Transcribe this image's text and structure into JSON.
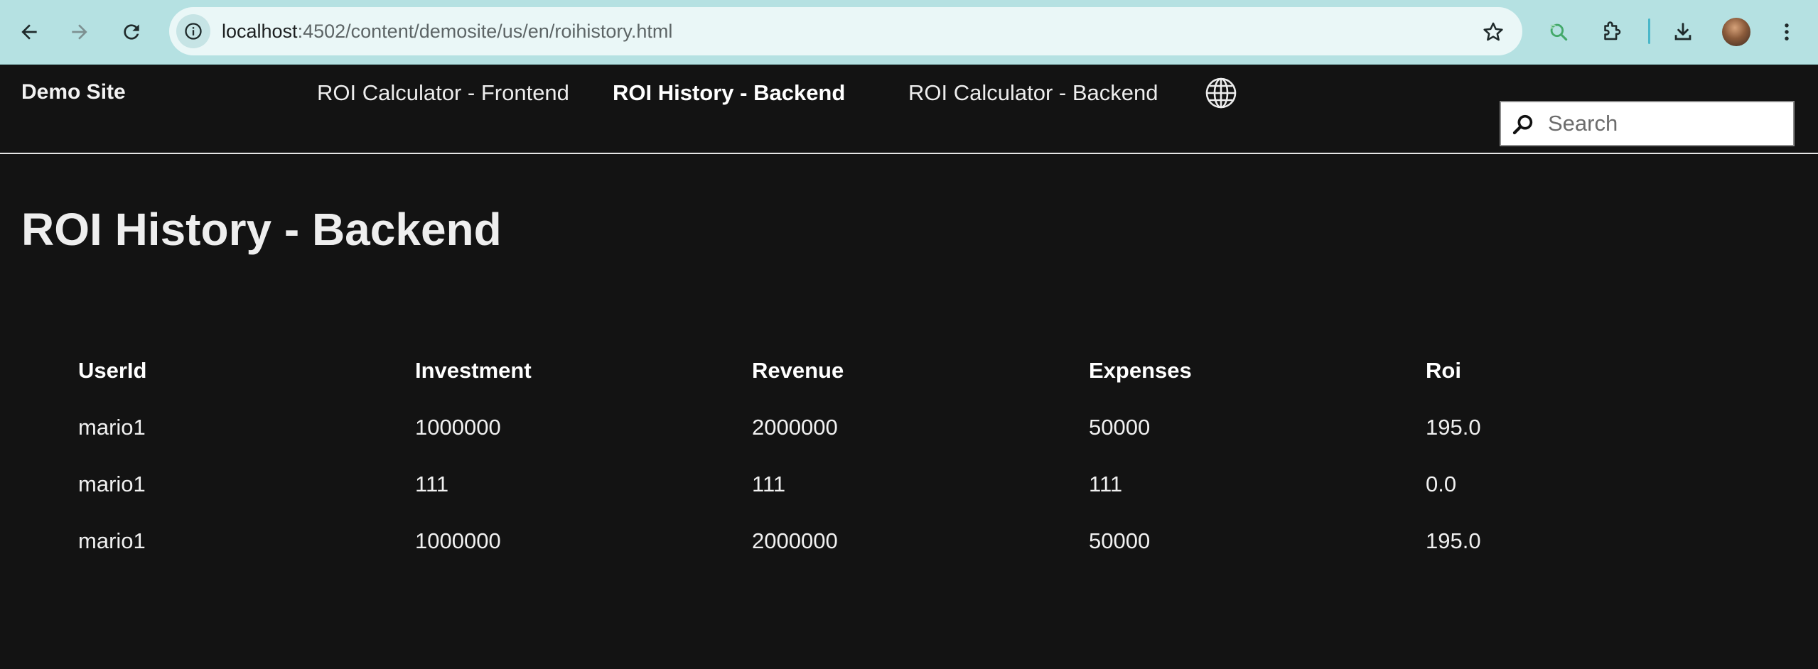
{
  "browser": {
    "url_host": "localhost",
    "url_path": ":4502/content/demosite/us/en/roihistory.html"
  },
  "header": {
    "brand": "Demo Site",
    "nav": [
      {
        "label": "ROI Calculator - Frontend",
        "active": false
      },
      {
        "label": "ROI History - Backend",
        "active": true
      },
      {
        "label": "ROI Calculator - Backend",
        "active": false
      }
    ],
    "search_placeholder": "Search"
  },
  "main": {
    "title": "ROI History - Backend",
    "table": {
      "columns": [
        "UserId",
        "Investment",
        "Revenue",
        "Expenses",
        "Roi"
      ],
      "rows": [
        [
          "mario1",
          "1000000",
          "2000000",
          "50000",
          "195.0"
        ],
        [
          "mario1",
          "111",
          "111",
          "111",
          "0.0"
        ],
        [
          "mario1",
          "1000000",
          "2000000",
          "50000",
          "195.0"
        ]
      ]
    }
  },
  "icons": {
    "back": "back-arrow-icon",
    "forward": "forward-arrow-icon",
    "reload": "reload-icon",
    "site_info": "info-icon",
    "bookmark": "star-icon",
    "extension_search": "google-lens-icon",
    "extensions": "puzzle-icon",
    "download": "download-icon",
    "menu": "more-vert-icon",
    "language": "globe-icon",
    "search": "search-icon"
  },
  "colors": {
    "browser_bar": "#b5e1e2",
    "page_background": "#131313",
    "text": "#f0f0f0"
  }
}
